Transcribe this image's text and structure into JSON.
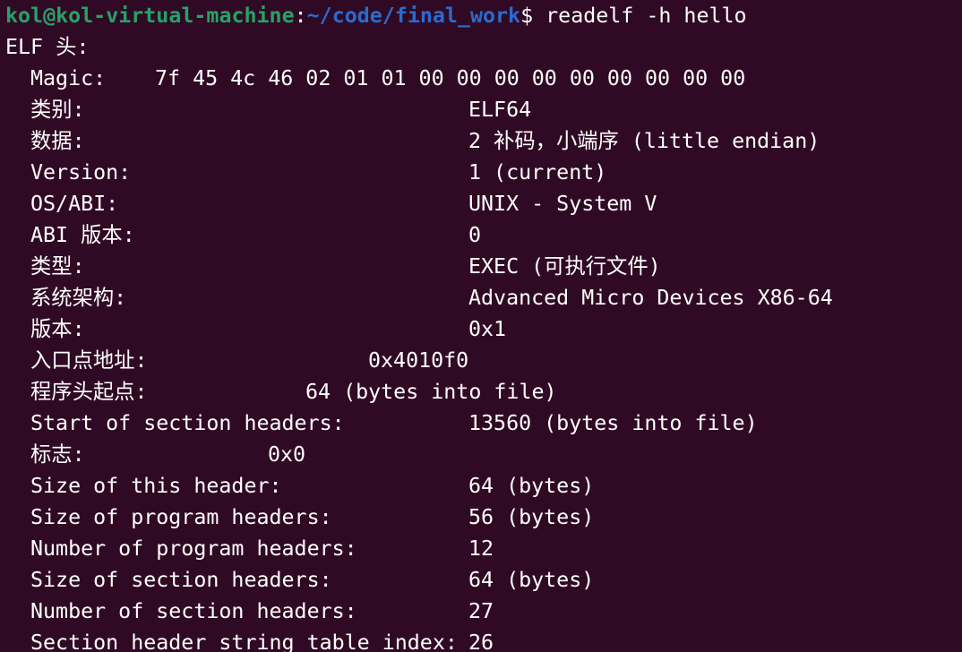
{
  "prompt": {
    "user_host": "kol@kol-virtual-machine",
    "colon": ":",
    "path": "~/code/final_work",
    "dollar": "$",
    "command": " readelf -h hello"
  },
  "elf_header": {
    "title": "ELF 头:",
    "fields": [
      {
        "label": "Magic:",
        "value": "7f 45 4c 46 02 01 01 00 00 00 00 00 00 00 00 00"
      },
      {
        "label": "类别:",
        "value": "ELF64"
      },
      {
        "label": "数据:",
        "value": "2 补码，小端序 (little endian)"
      },
      {
        "label": "Version:",
        "value": "1 (current)"
      },
      {
        "label": "OS/ABI:",
        "value": "UNIX - System V"
      },
      {
        "label": "ABI 版本:",
        "value": "0"
      },
      {
        "label": "类型:",
        "value": "EXEC (可执行文件)"
      },
      {
        "label": "系统架构:",
        "value": "Advanced Micro Devices X86-64"
      },
      {
        "label": "版本:",
        "value": "0x1"
      },
      {
        "label": "入口点地址:",
        "value": "0x4010f0"
      },
      {
        "label": "程序头起点:",
        "value": "64 (bytes into file)"
      },
      {
        "label": "Start of section headers:",
        "value": "13560 (bytes into file)"
      },
      {
        "label": "标志:",
        "value": "0x0"
      },
      {
        "label": "Size of this header:",
        "value": "64 (bytes)"
      },
      {
        "label": "Size of program headers:",
        "value": "56 (bytes)"
      },
      {
        "label": "Number of program headers:",
        "value": "12"
      },
      {
        "label": "Size of section headers:",
        "value": "64 (bytes)"
      },
      {
        "label": "Number of section headers:",
        "value": "27"
      },
      {
        "label": "Section header string table index:",
        "value": "26"
      }
    ]
  },
  "colors": {
    "background": "#300a24",
    "prompt_user": "#26a269",
    "prompt_path": "#2a6bd1",
    "text": "#ffffff"
  }
}
